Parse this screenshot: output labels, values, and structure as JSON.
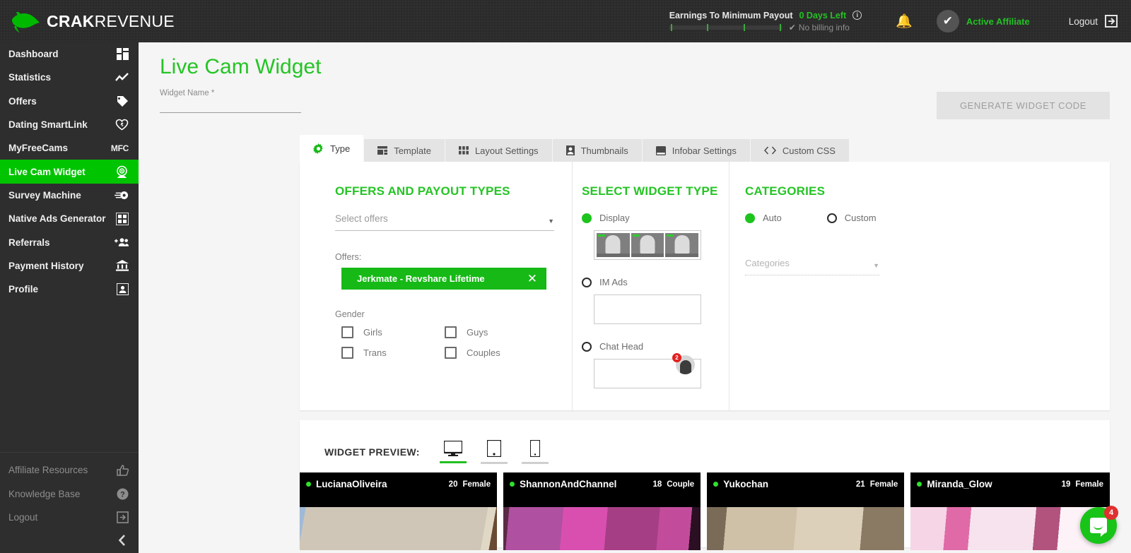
{
  "brand": {
    "name_bold": "CRAK",
    "name_light": "REVENUE",
    "accent": "#00c400"
  },
  "topbar": {
    "earnings_label": "Earnings To Minimum Payout",
    "days_left": "0 Days Left",
    "info_icon": "info-icon",
    "no_billing": "No billing info",
    "bell_icon": "bell-icon",
    "affiliate_status": "Active Affiliate",
    "logout_label": "Logout",
    "logout_icon": "logout-icon"
  },
  "sidebar": {
    "items": [
      {
        "label": "Dashboard",
        "icon": "dashboard-icon"
      },
      {
        "label": "Statistics",
        "icon": "chart-line-icon"
      },
      {
        "label": "Offers",
        "icon": "tag-icon"
      },
      {
        "label": "Dating SmartLink",
        "icon": "heart-link-icon"
      },
      {
        "label": "MyFreeCams",
        "icon": "mfc-icon"
      },
      {
        "label": "Live Cam Widget",
        "icon": "webcam-icon",
        "active": true
      },
      {
        "label": "Survey Machine",
        "icon": "survey-gear-icon"
      },
      {
        "label": "Native Ads Generator",
        "icon": "grid-ads-icon"
      },
      {
        "label": "Referrals",
        "icon": "add-people-icon"
      },
      {
        "label": "Payment History",
        "icon": "bank-icon"
      },
      {
        "label": "Profile",
        "icon": "id-card-icon"
      }
    ],
    "bottom_items": [
      {
        "label": "Affiliate Resources",
        "icon": "thumbs-up-icon"
      },
      {
        "label": "Knowledge Base",
        "icon": "question-circle-icon"
      },
      {
        "label": "Logout",
        "icon": "logout-icon"
      }
    ],
    "collapse_icon": "chevron-left-icon"
  },
  "page": {
    "title": "Live Cam Widget",
    "widget_name_label": "Widget Name *",
    "widget_name_value": "",
    "widget_name_placeholder": "",
    "generate_button": "GENERATE WIDGET CODE"
  },
  "tabs": [
    {
      "label": "Type",
      "icon": "gear-icon",
      "active": true
    },
    {
      "label": "Template",
      "icon": "template-icon"
    },
    {
      "label": "Layout Settings",
      "icon": "layout-grid-icon"
    },
    {
      "label": "Thumbnails",
      "icon": "thumbnail-icon"
    },
    {
      "label": "Infobar Settings",
      "icon": "infobar-icon"
    },
    {
      "label": "Custom CSS",
      "icon": "code-icon"
    }
  ],
  "offers_panel": {
    "heading": "OFFERS AND PAYOUT TYPES",
    "select_offers_placeholder": "Select offers",
    "select_offers_value": "",
    "offers_label": "Offers:",
    "selected_offers": [
      {
        "label": "Jerkmate - Revshare Lifetime",
        "remove_icon": "close-icon"
      }
    ],
    "gender_label": "Gender",
    "gender_options": [
      {
        "label": "Girls",
        "checked": false
      },
      {
        "label": "Guys",
        "checked": false
      },
      {
        "label": "Trans",
        "checked": false
      },
      {
        "label": "Couples",
        "checked": false
      }
    ]
  },
  "widget_type_panel": {
    "heading": "SELECT WIDGET TYPE",
    "options": [
      {
        "label": "Display",
        "selected": true
      },
      {
        "label": "IM Ads",
        "selected": false
      },
      {
        "label": "Chat Head",
        "selected": false
      }
    ],
    "chat_head_badge": "2"
  },
  "categories_panel": {
    "heading": "CATEGORIES",
    "mode_options": [
      {
        "label": "Auto",
        "selected": true
      },
      {
        "label": "Custom",
        "selected": false
      }
    ],
    "categories_placeholder": "Categories",
    "categories_value": ""
  },
  "preview": {
    "title": "WIDGET PREVIEW:",
    "devices": [
      {
        "name": "desktop-icon",
        "active": true
      },
      {
        "name": "tablet-icon",
        "active": false
      },
      {
        "name": "mobile-icon",
        "active": false
      }
    ],
    "cards": [
      {
        "name": "LucianaOliveira",
        "age": "20",
        "gender": "Female",
        "online": true
      },
      {
        "name": "ShannonAndChannel",
        "age": "18",
        "gender": "Couple",
        "online": true
      },
      {
        "name": "Yukochan",
        "age": "21",
        "gender": "Female",
        "online": true
      },
      {
        "name": "Miranda_Glow",
        "age": "19",
        "gender": "Female",
        "online": true
      }
    ]
  },
  "intercom": {
    "badge": "4",
    "icon": "chat-bubble-icon"
  }
}
